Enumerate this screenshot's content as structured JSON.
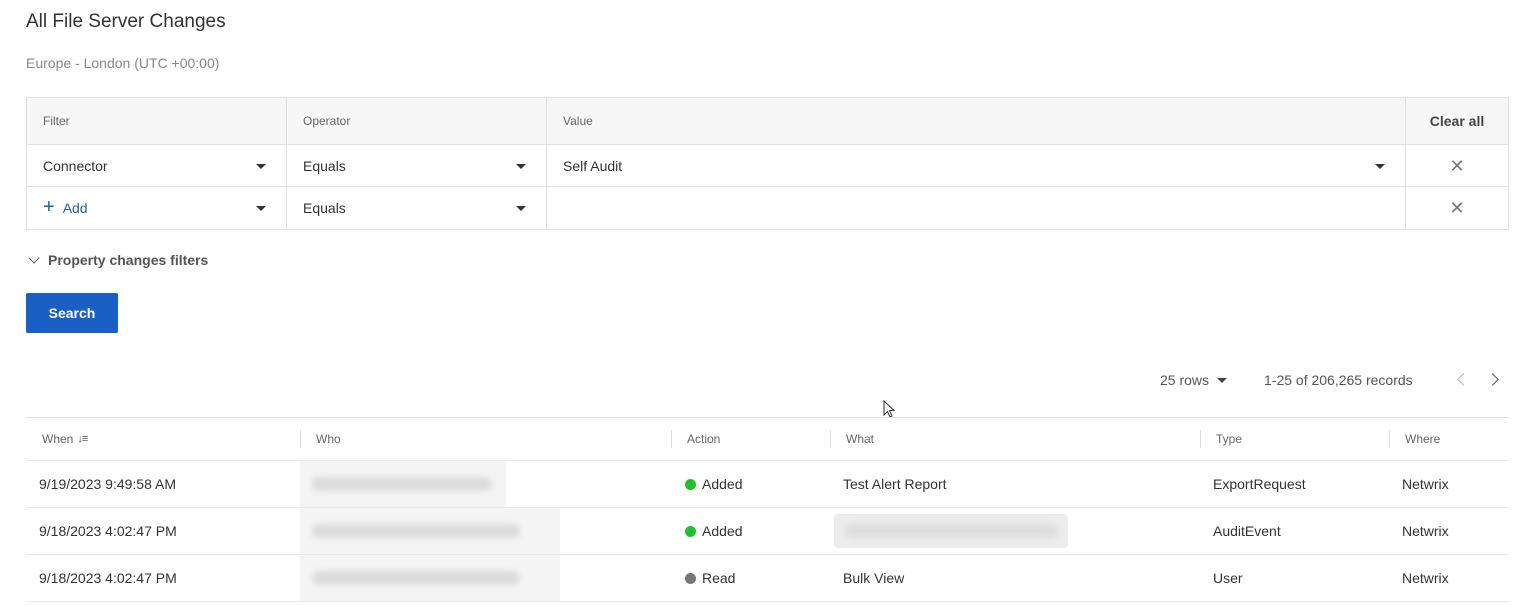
{
  "page": {
    "title": "All File Server Changes",
    "timezone": "Europe - London (UTC +00:00)"
  },
  "filters": {
    "headers": {
      "filter": "Filter",
      "operator": "Operator",
      "value": "Value",
      "clear_all": "Clear all"
    },
    "rows": [
      {
        "filter": "Connector",
        "operator": "Equals",
        "value": "Self Audit"
      },
      {
        "filter": "Add",
        "operator": "Equals",
        "value": ""
      }
    ],
    "remove_icon": "close-icon",
    "property_changes_label": "Property changes filters"
  },
  "search": {
    "label": "Search"
  },
  "pager": {
    "rows_label": "25 rows",
    "records_label": "1-25 of 206,265 records"
  },
  "table": {
    "columns": {
      "when": "When",
      "who": "Who",
      "action": "Action",
      "what": "What",
      "type": "Type",
      "where": "Where"
    },
    "sort_icon": "↓≡",
    "rows": [
      {
        "when": "9/19/2023 9:49:58 AM",
        "action": "Added",
        "action_color": "#22c02e",
        "what": "Test Alert Report",
        "type": "ExportRequest",
        "where": "Netwrix"
      },
      {
        "when": "9/18/2023 4:02:47 PM",
        "action": "Added",
        "action_color": "#22c02e",
        "what": "",
        "type": "AuditEvent",
        "where": "Netwrix"
      },
      {
        "when": "9/18/2023 4:02:47 PM",
        "action": "Read",
        "action_color": "#777777",
        "what": "Bulk View",
        "type": "User",
        "where": "Netwrix"
      }
    ]
  },
  "colors": {
    "primary": "#1a5fc4",
    "link": "#1a5fb4"
  }
}
